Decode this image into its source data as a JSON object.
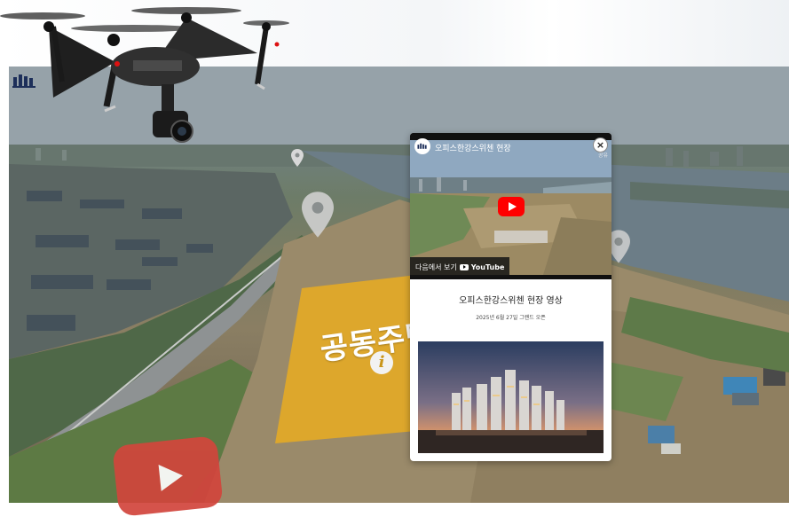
{
  "popup": {
    "video_title": "오피스한강스위첸 현장",
    "video_share_label": "공유",
    "watch_on_label": "다음에서 보기",
    "youtube_label": "YouTube",
    "close_label": "×",
    "title": "오피스한강스위첸 현장 영상",
    "date_text": "2025년 6월 27일 그랜드 오픈"
  },
  "map": {
    "zone_label": "공동주택",
    "info_label": "i"
  },
  "icons": [
    "drone-icon",
    "map-pin-icon",
    "play-icon",
    "close-icon",
    "youtube-icon",
    "logo-icon",
    "info-icon"
  ],
  "colors": {
    "zone_yellow": "#e3a927",
    "play_red": "#d2453c",
    "youtube_red": "#ff0000"
  }
}
